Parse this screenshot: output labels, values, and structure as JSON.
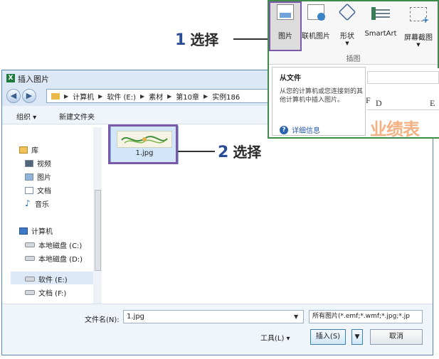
{
  "annotations": {
    "step1": {
      "num": "1",
      "text": "选择"
    },
    "step2": {
      "num": "2",
      "text": "选择"
    }
  },
  "ribbon": {
    "buttons": [
      {
        "label": "图片",
        "icon": "picture-icon"
      },
      {
        "label": "联机图片",
        "icon": "online-picture-icon"
      },
      {
        "label": "形状",
        "icon": "shapes-icon"
      },
      {
        "label": "SmartArt",
        "icon": "smartart-icon"
      },
      {
        "label": "屏幕截图",
        "icon": "screenshot-icon"
      }
    ],
    "group_label": "插图",
    "tooltip": {
      "title": "从文件",
      "body": "从您的计算机或您连接到的其他计算机中插入图片。",
      "link": "详细信息"
    }
  },
  "sheet": {
    "col_partial": "F",
    "col_d": "D",
    "col_e": "E",
    "title_fragment": "业绩表"
  },
  "dialog": {
    "title": "插入图片",
    "breadcrumb": [
      "计算机",
      "软件 (E:)",
      "素材",
      "第10章",
      "实例186"
    ],
    "toolbar": {
      "organize": "组织 ▾",
      "new_folder": "新建文件夹"
    },
    "tree": {
      "library": "库",
      "video": "视频",
      "pictures": "图片",
      "documents": "文档",
      "music": "音乐",
      "computer": "计算机",
      "disk_c": "本地磁盘 (C:)",
      "disk_d": "本地磁盘 (D:)",
      "disk_e": "软件 (E:)",
      "disk_f": "文档 (F:)"
    },
    "file": {
      "name": "1.jpg"
    },
    "filename_label": "文件名(N):",
    "filename_value": "1.jpg",
    "filetype_value": "所有图片(*.emf;*.wmf;*.jpg;*.jp",
    "tools_label": "工具(L)  ▾",
    "insert_label": "插入(S)",
    "cancel_label": "取消"
  },
  "colors": {
    "highlight": "#7a5aa7",
    "excel_green": "#3e8a4a",
    "callout_num": "#2b4d96"
  }
}
